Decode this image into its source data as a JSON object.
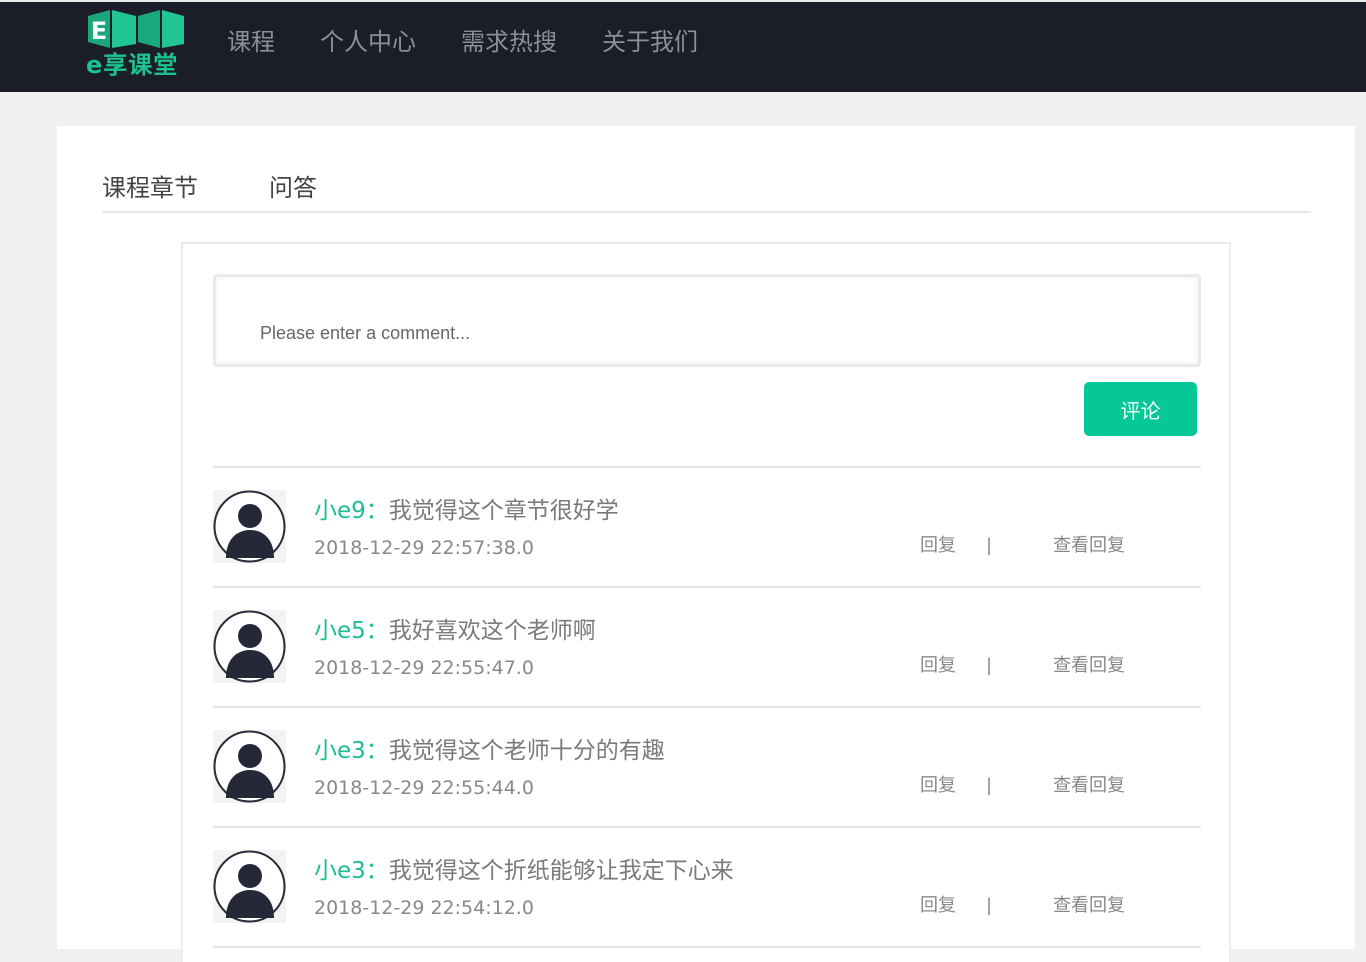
{
  "header": {
    "logo_text": "EXKT",
    "logo_subtitle": "e享课堂",
    "nav": [
      {
        "label": "课程"
      },
      {
        "label": "个人中心"
      },
      {
        "label": "需求热搜"
      },
      {
        "label": "关于我们"
      }
    ]
  },
  "tabs": [
    {
      "label": "课程章节"
    },
    {
      "label": "问答"
    }
  ],
  "comment_form": {
    "placeholder": "Please enter a comment...",
    "submit_label": "评论"
  },
  "comments": [
    {
      "user": "小e9",
      "colon": "：",
      "text": "我觉得这个章节很好学",
      "time": "2018-12-29 22:57:38.0",
      "reply_label": "回复",
      "separator": "|",
      "view_replies_label": "查看回复"
    },
    {
      "user": "小e5",
      "colon": "：",
      "text": "我好喜欢这个老师啊",
      "time": "2018-12-29 22:55:47.0",
      "reply_label": "回复",
      "separator": "|",
      "view_replies_label": "查看回复"
    },
    {
      "user": "小e3",
      "colon": "：",
      "text": "我觉得这个老师十分的有趣",
      "time": "2018-12-29 22:55:44.0",
      "reply_label": "回复",
      "separator": "|",
      "view_replies_label": "查看回复"
    },
    {
      "user": "小e3",
      "colon": "：",
      "text": "我觉得这个折纸能够让我定下心来",
      "time": "2018-12-29 22:54:12.0",
      "reply_label": "回复",
      "separator": "|",
      "view_replies_label": "查看回复"
    }
  ],
  "colors": {
    "accent": "#05c797",
    "header_bg": "#1b1e28",
    "username": "#1dbf8f"
  },
  "icons": {
    "avatar": "user-avatar-icon"
  }
}
